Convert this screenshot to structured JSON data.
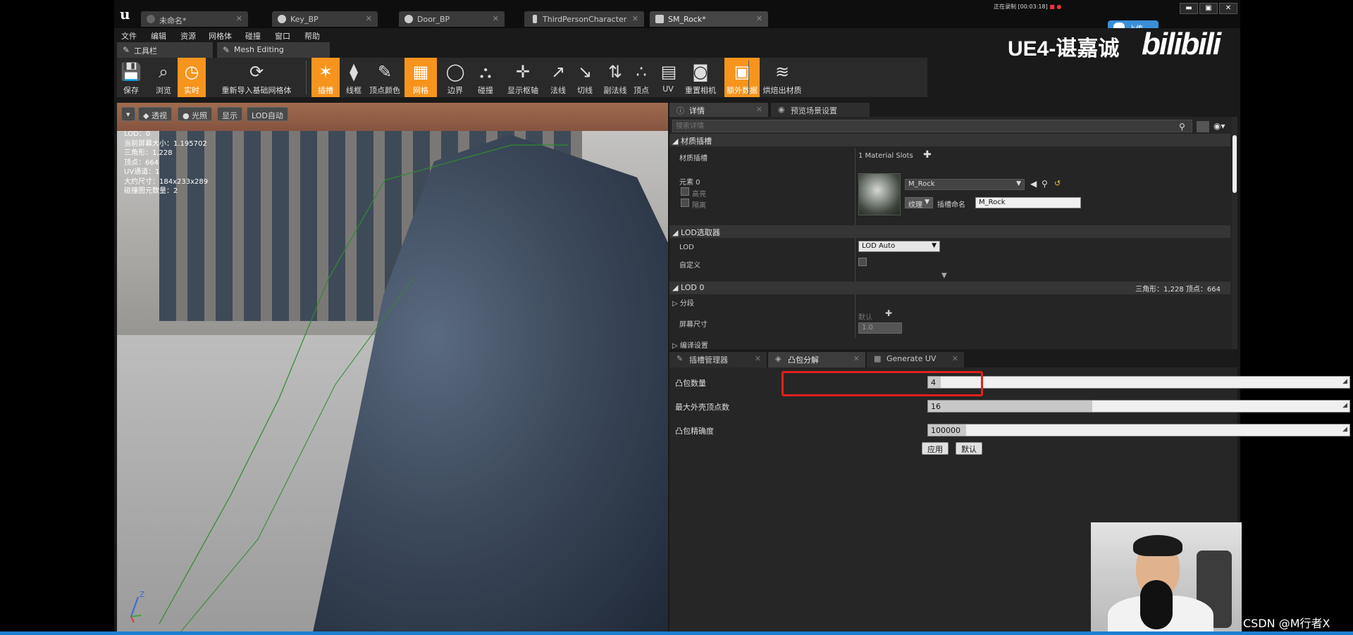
{
  "doc_tabs": [
    "未命名*",
    "Key_BP",
    "Door_BP",
    "ThirdPersonCharacter",
    "SM_Rock*"
  ],
  "recorder": {
    "status": "正在录制",
    "time": "[00:03:18]"
  },
  "upload": {
    "label": "上传"
  },
  "menu": [
    "文件",
    "编辑",
    "资源",
    "网格体",
    "碰撞",
    "窗口",
    "帮助"
  ],
  "watermark": {
    "title": "UE4-谌嘉诚",
    "brand": "bilibili"
  },
  "toolbar_tabs": [
    "工具栏",
    "Mesh Editing"
  ],
  "toolbar": [
    {
      "label": "保存",
      "icon": "save-icon",
      "active": false
    },
    {
      "label": "浏览",
      "icon": "browse-icon",
      "active": false
    },
    {
      "label": "实时",
      "icon": "realtime-icon",
      "active": true
    },
    {
      "label": "重新导入基础网格体",
      "icon": "reimport-icon",
      "active": false
    },
    {
      "label": "插槽",
      "icon": "socket-icon",
      "active": true
    },
    {
      "label": "线框",
      "icon": "wireframe-icon",
      "active": false
    },
    {
      "label": "顶点颜色",
      "icon": "vertex-color-icon",
      "active": false
    },
    {
      "label": "网格",
      "icon": "grid-icon",
      "active": true
    },
    {
      "label": "边界",
      "icon": "bounds-icon",
      "active": false
    },
    {
      "label": "碰撞",
      "icon": "collision-icon",
      "active": false
    },
    {
      "label": "显示枢轴",
      "icon": "pivot-icon",
      "active": false
    },
    {
      "label": "法线",
      "icon": "normals-icon",
      "active": false
    },
    {
      "label": "切线",
      "icon": "tangents-icon",
      "active": false
    },
    {
      "label": "副法线",
      "icon": "binormals-icon",
      "active": false
    },
    {
      "label": "顶点",
      "icon": "vertices-icon",
      "active": false
    },
    {
      "label": "UV",
      "icon": "uv-icon",
      "active": false
    },
    {
      "label": "重置相机",
      "icon": "reset-camera-icon",
      "active": false
    },
    {
      "label": "额外数据",
      "icon": "additional-data-icon",
      "active": true
    },
    {
      "label": "烘焙出材质",
      "icon": "bake-material-icon",
      "active": false
    }
  ],
  "viewport": {
    "buttons": [
      "透视",
      "光照",
      "显示",
      "LOD自动"
    ],
    "stats": [
      "LOD：0",
      "当前屏幕大小：1.195702",
      "三角形：1,228",
      "顶点：664",
      "UV通道：1",
      "大约尺寸：184x233x289",
      "碰撞图元数量：2"
    ],
    "axis": {
      "z": "Z"
    }
  },
  "details": {
    "tabs": [
      "详情",
      "预览场景设置"
    ],
    "search_placeholder": "搜索详情",
    "material_section": "材质插槽",
    "material_slots_label": "材质插槽",
    "material_slots_value": "1 Material Slots",
    "element_label": "元素 0",
    "highlight_label": "高亮",
    "isolate_label": "隔离",
    "material_name": "M_Rock",
    "texture_btn": "纹理",
    "slot_name_label": "插槽命名",
    "slot_name_value": "M_Rock",
    "lod_picker_section": "LOD选取器",
    "lod_label": "LOD",
    "lod_value": "LOD Auto",
    "custom_label": "自定义",
    "lod0_section": "LOD 0",
    "lod0_info": "三角形：1,228  顶点：664",
    "sections_label": "分段",
    "screen_size_label": "屏幕尺寸",
    "screen_size_default": "默认",
    "screen_size_value": "1.0",
    "build_settings_label": "编译设置"
  },
  "convex": {
    "tabs": [
      "插槽管理器",
      "凸包分解",
      "Generate UV"
    ],
    "rows": [
      {
        "label": "凸包数量",
        "value": "4",
        "fill": 0.03
      },
      {
        "label": "最大外壳顶点数",
        "value": "16",
        "fill": 0.39
      },
      {
        "label": "凸包精确度",
        "value": "100000",
        "fill": 0.09
      }
    ],
    "apply_btn": "应用",
    "default_btn": "默认"
  },
  "credit": "CSDN @M行者X",
  "colors": {
    "accent": "#f7941d",
    "highlight": "#e0201e",
    "upload": "#3a8fd8"
  }
}
